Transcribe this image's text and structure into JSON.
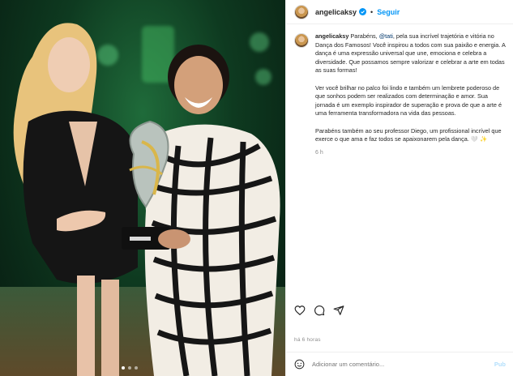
{
  "post": {
    "username": "angelicaksy",
    "separator": "•",
    "follow_label": "Seguir",
    "caption": {
      "username": "angelicaksy",
      "p1_pre": "Parabéns, ",
      "p1_mention": "@tati",
      "p1_post": ", pela sua incrível trajetória e vitória no Dança dos Famosos! Você inspirou a todos com sua paixão e energia. A dança é uma expressão universal que une, emociona e celebra a diversidade. Que possamos sempre valorizar e celebrar a arte em todas as suas formas!",
      "p2": "Ver você brilhar no palco foi lindo e também um lembrete poderoso de que sonhos podem ser realizados com determinação e amor. Sua jornada é um exemplo inspirador de superação e prova de que a arte é uma ferramenta transformadora na vida das pessoas.",
      "p3": "Parabéns também ao seu professor Diego, um profissional incrível que exerce o que ama e faz todos se apaixonarem pela dança. 🤍 ✨",
      "age": "6 h"
    },
    "posted_ago": "há 6 horas",
    "comment_placeholder": "Adicionar um comentário...",
    "post_label": "Pub",
    "carousel_dots": 3,
    "colors": {
      "link_blue": "#0095f6",
      "mention": "#00376b",
      "muted": "#8e8e8e",
      "post_disabled": "#b2dffc"
    },
    "icons": [
      "verified-badge-icon",
      "heart-icon",
      "comment-icon",
      "share-icon",
      "emoji-icon"
    ]
  }
}
